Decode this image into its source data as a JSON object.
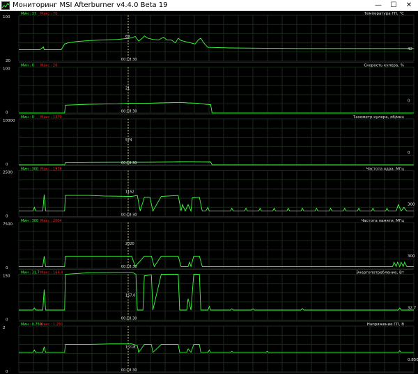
{
  "window": {
    "title": "Мониторинг MSI Afterburner v4.4.0 Beta 19",
    "buttons": {
      "minimize": "—",
      "maximize": "☐",
      "close": "✕"
    }
  },
  "colors": {
    "background": "#000000",
    "grid": "#1b2a1b",
    "line": "#3cff3c",
    "label_min": "#3cff3c",
    "label_max": "#ff2020",
    "marker": "#d6d68a",
    "text": "#e8e8e8"
  },
  "cursor_time": "00:18:30",
  "graphs": [
    {
      "name": "gpu-temperature",
      "title": "Температура ГП, °C",
      "min_label": "Мин : 37",
      "max_label": "Макс : 70",
      "ylim": [
        20,
        100
      ],
      "top_tick": "100",
      "bottom_tick": "20",
      "cursor_value": "69",
      "current_value": "42",
      "series": [
        [
          0,
          40
        ],
        [
          30,
          40
        ],
        [
          35,
          45
        ],
        [
          36,
          40
        ],
        [
          60,
          40
        ],
        [
          65,
          50
        ],
        [
          70,
          52
        ],
        [
          80,
          54
        ],
        [
          100,
          56
        ],
        [
          120,
          57
        ],
        [
          140,
          58
        ],
        [
          157,
          60
        ],
        [
          165,
          63
        ],
        [
          170,
          55
        ],
        [
          175,
          60
        ],
        [
          178,
          64
        ],
        [
          183,
          60
        ],
        [
          190,
          58
        ],
        [
          198,
          57
        ],
        [
          205,
          62
        ],
        [
          210,
          57
        ],
        [
          216,
          57
        ],
        [
          222,
          52
        ],
        [
          226,
          60
        ],
        [
          230,
          56
        ],
        [
          240,
          53
        ],
        [
          250,
          50
        ],
        [
          255,
          58
        ],
        [
          258,
          60
        ],
        [
          262,
          52
        ],
        [
          268,
          44
        ],
        [
          270,
          44
        ],
        [
          300,
          43
        ],
        [
          400,
          42
        ],
        [
          500,
          42
        ],
        [
          540,
          42
        ],
        [
          560,
          42
        ]
      ]
    },
    {
      "name": "fan-speed",
      "title": "Скорость кулера, %",
      "min_label": "Мин : 0",
      "max_label": "Макс : 26",
      "ylim": [
        0,
        100
      ],
      "top_tick": "100",
      "bottom_tick": "0",
      "cursor_value": "21",
      "current_value": "0",
      "series": [
        [
          0,
          0
        ],
        [
          65,
          0
        ],
        [
          66,
          17
        ],
        [
          100,
          19
        ],
        [
          140,
          20
        ],
        [
          155,
          21
        ],
        [
          180,
          21
        ],
        [
          200,
          22
        ],
        [
          230,
          23
        ],
        [
          240,
          22
        ],
        [
          255,
          21
        ],
        [
          265,
          19
        ],
        [
          272,
          18
        ],
        [
          274,
          0
        ],
        [
          560,
          0
        ]
      ]
    },
    {
      "name": "fan-tachometer",
      "title": "Тахометр кулера, об/мин",
      "min_label": "Мин : 0",
      "max_label": "Макс : 1470",
      "ylim": [
        0,
        10000
      ],
      "top_tick": "10000",
      "bottom_tick": "0",
      "cursor_value": "574",
      "current_value": "0",
      "series": [
        [
          0,
          0
        ],
        [
          65,
          0
        ],
        [
          66,
          500
        ],
        [
          100,
          560
        ],
        [
          140,
          580
        ],
        [
          160,
          574
        ],
        [
          180,
          574
        ],
        [
          220,
          620
        ],
        [
          240,
          640
        ],
        [
          260,
          620
        ],
        [
          272,
          600
        ],
        [
          274,
          0
        ],
        [
          560,
          0
        ]
      ]
    },
    {
      "name": "core-clock",
      "title": "Частота ядра, МГц",
      "min_label": "Мин : 300",
      "max_label": "Макс : 1978",
      "ylim": [
        0,
        2500
      ],
      "top_tick": "2500",
      "bottom_tick": "0",
      "cursor_value": "1152",
      "current_value": "300",
      "series": [
        [
          0,
          300
        ],
        [
          20,
          300
        ],
        [
          22,
          500
        ],
        [
          24,
          300
        ],
        [
          34,
          300
        ],
        [
          36,
          1200
        ],
        [
          38,
          300
        ],
        [
          65,
          300
        ],
        [
          66,
          1150
        ],
        [
          100,
          1150
        ],
        [
          120,
          1120
        ],
        [
          160,
          1100
        ],
        [
          168,
          1150
        ],
        [
          172,
          300
        ],
        [
          178,
          1050
        ],
        [
          186,
          1050
        ],
        [
          190,
          300
        ],
        [
          202,
          1100
        ],
        [
          226,
          1150
        ],
        [
          230,
          300
        ],
        [
          232,
          650
        ],
        [
          236,
          300
        ],
        [
          240,
          650
        ],
        [
          244,
          300
        ],
        [
          246,
          1020
        ],
        [
          256,
          1050
        ],
        [
          260,
          300
        ],
        [
          265,
          300
        ],
        [
          268,
          500
        ],
        [
          270,
          300
        ],
        [
          300,
          300
        ],
        [
          302,
          450
        ],
        [
          304,
          300
        ],
        [
          320,
          300
        ],
        [
          322,
          450
        ],
        [
          324,
          300
        ],
        [
          340,
          300
        ],
        [
          342,
          450
        ],
        [
          344,
          300
        ],
        [
          360,
          300
        ],
        [
          362,
          450
        ],
        [
          364,
          300
        ],
        [
          380,
          300
        ],
        [
          382,
          450
        ],
        [
          384,
          300
        ],
        [
          400,
          300
        ],
        [
          402,
          450
        ],
        [
          404,
          300
        ],
        [
          420,
          300
        ],
        [
          422,
          450
        ],
        [
          424,
          300
        ],
        [
          440,
          300
        ],
        [
          442,
          450
        ],
        [
          444,
          300
        ],
        [
          460,
          300
        ],
        [
          462,
          450
        ],
        [
          464,
          300
        ],
        [
          480,
          300
        ],
        [
          482,
          450
        ],
        [
          484,
          300
        ],
        [
          500,
          300
        ],
        [
          502,
          450
        ],
        [
          504,
          300
        ],
        [
          520,
          300
        ],
        [
          522,
          450
        ],
        [
          524,
          300
        ],
        [
          535,
          300
        ],
        [
          538,
          650
        ],
        [
          542,
          300
        ],
        [
          546,
          500
        ],
        [
          550,
          300
        ],
        [
          560,
          300
        ]
      ]
    },
    {
      "name": "memory-clock",
      "title": "Частота памяти, МГц",
      "min_label": "Мин : 300",
      "max_label": "Макс : 2004",
      "ylim": [
        0,
        7500
      ],
      "top_tick": "7500",
      "bottom_tick": "0",
      "cursor_value": "2020",
      "current_value": "300",
      "series": [
        [
          0,
          300
        ],
        [
          34,
          300
        ],
        [
          36,
          2000
        ],
        [
          38,
          300
        ],
        [
          65,
          300
        ],
        [
          66,
          2000
        ],
        [
          160,
          2000
        ],
        [
          165,
          300
        ],
        [
          178,
          2000
        ],
        [
          188,
          2000
        ],
        [
          192,
          300
        ],
        [
          202,
          2000
        ],
        [
          226,
          2000
        ],
        [
          230,
          300
        ],
        [
          240,
          300
        ],
        [
          242,
          1000
        ],
        [
          244,
          300
        ],
        [
          248,
          2000
        ],
        [
          256,
          2000
        ],
        [
          260,
          300
        ],
        [
          560,
          300
        ],
        [
          530,
          300
        ],
        [
          532,
          1000
        ],
        [
          535,
          300
        ],
        [
          537,
          1000
        ],
        [
          540,
          300
        ],
        [
          542,
          1000
        ],
        [
          545,
          300
        ],
        [
          547,
          1000
        ],
        [
          550,
          300
        ]
      ]
    },
    {
      "name": "power-consumption",
      "title": "Энергопотребление, Вт",
      "min_label": "Мин : 31.7",
      "max_label": "Макс : 164.4",
      "ylim": [
        0,
        150
      ],
      "top_tick": "150",
      "bottom_tick": "0",
      "cursor_value": "157.0",
      "current_value": "32.7",
      "series": [
        [
          0,
          33
        ],
        [
          20,
          33
        ],
        [
          22,
          40
        ],
        [
          24,
          33
        ],
        [
          34,
          33
        ],
        [
          36,
          100
        ],
        [
          38,
          33
        ],
        [
          65,
          33
        ],
        [
          66,
          150
        ],
        [
          100,
          155
        ],
        [
          160,
          157
        ],
        [
          166,
          150
        ],
        [
          168,
          33
        ],
        [
          176,
          33
        ],
        [
          178,
          145
        ],
        [
          188,
          148
        ],
        [
          190,
          33
        ],
        [
          202,
          150
        ],
        [
          226,
          150
        ],
        [
          228,
          33
        ],
        [
          238,
          33
        ],
        [
          240,
          70
        ],
        [
          244,
          33
        ],
        [
          248,
          150
        ],
        [
          256,
          150
        ],
        [
          258,
          33
        ],
        [
          268,
          33
        ],
        [
          270,
          45
        ],
        [
          272,
          33
        ],
        [
          300,
          33
        ],
        [
          302,
          37
        ],
        [
          304,
          33
        ],
        [
          330,
          33
        ],
        [
          332,
          37
        ],
        [
          334,
          33
        ],
        [
          400,
          33
        ],
        [
          402,
          38
        ],
        [
          404,
          33
        ],
        [
          538,
          33
        ],
        [
          540,
          40
        ],
        [
          542,
          33
        ],
        [
          560,
          33
        ]
      ]
    },
    {
      "name": "gpu-voltage",
      "title": "Напряжение ГП, В",
      "min_label": "Мин : 0.750",
      "max_label": "Макс : 1.250",
      "ylim": [
        0,
        2
      ],
      "top_tick": "2",
      "bottom_tick": "0",
      "cursor_value": "1.218",
      "current_value": "0.850",
      "series": [
        [
          0,
          0.85
        ],
        [
          20,
          0.85
        ],
        [
          22,
          0.95
        ],
        [
          24,
          0.85
        ],
        [
          34,
          0.85
        ],
        [
          36,
          1.1
        ],
        [
          38,
          0.85
        ],
        [
          65,
          0.85
        ],
        [
          66,
          1.2
        ],
        [
          100,
          1.2
        ],
        [
          130,
          1.22
        ],
        [
          160,
          1.22
        ],
        [
          168,
          1.15
        ],
        [
          170,
          0.85
        ],
        [
          178,
          1.2
        ],
        [
          188,
          1.2
        ],
        [
          190,
          0.85
        ],
        [
          202,
          1.2
        ],
        [
          226,
          1.2
        ],
        [
          228,
          0.85
        ],
        [
          238,
          0.85
        ],
        [
          240,
          1.0
        ],
        [
          244,
          0.85
        ],
        [
          248,
          1.2
        ],
        [
          256,
          1.2
        ],
        [
          258,
          0.85
        ],
        [
          268,
          0.85
        ],
        [
          270,
          0.95
        ],
        [
          272,
          0.85
        ],
        [
          300,
          0.85
        ],
        [
          302,
          0.9
        ],
        [
          304,
          0.85
        ],
        [
          350,
          0.85
        ],
        [
          352,
          0.9
        ],
        [
          354,
          0.85
        ],
        [
          538,
          0.85
        ],
        [
          540,
          0.92
        ],
        [
          542,
          0.85
        ],
        [
          560,
          0.85
        ]
      ]
    }
  ]
}
